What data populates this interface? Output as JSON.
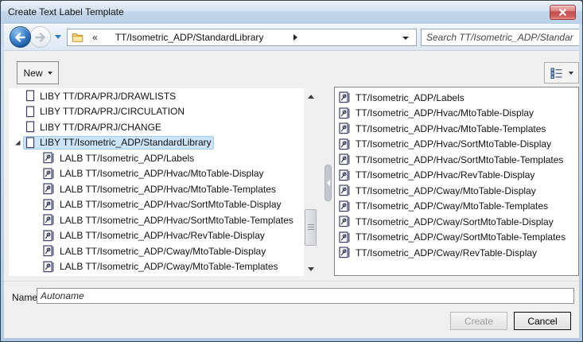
{
  "window": {
    "title": "Create Text Label Template"
  },
  "navbar": {
    "address_overflow_glyph": "«",
    "address_path": "TT/Isometric_ADP/StandardLibrary",
    "search_placeholder": "Search TT/Isometric_ADP/Standar"
  },
  "toolbar": {
    "new_button": "New"
  },
  "icons": {
    "close": "close-icon",
    "back": "back-arrow-icon",
    "forward": "forward-arrow-icon",
    "folder": "folder-icon",
    "view_mode": "details-view-icon",
    "library": "library-icon",
    "label_template": "label-template-icon"
  },
  "left_tree": {
    "items": [
      {
        "label": "LIBY TT/DRA/PRJ/DRAWLISTS",
        "level": 0,
        "icon": "library-icon",
        "selected": false,
        "expanded": false
      },
      {
        "label": "LIBY TT/DRA/PRJ/CIRCULATION",
        "level": 0,
        "icon": "library-icon",
        "selected": false,
        "expanded": false
      },
      {
        "label": "LIBY TT/DRA/PRJ/CHANGE",
        "level": 0,
        "icon": "library-icon",
        "selected": false,
        "expanded": false
      },
      {
        "label": "LIBY TT/Isometric_ADP/StandardLibrary",
        "level": 0,
        "icon": "library-icon",
        "selected": true,
        "expanded": true
      },
      {
        "label": "LALB TT/Isometric_ADP/Labels",
        "level": 1,
        "icon": "label-template-icon",
        "selected": false,
        "expanded": false
      },
      {
        "label": "LALB TT/Isometric_ADP/Hvac/MtoTable-Display",
        "level": 1,
        "icon": "label-template-icon",
        "selected": false,
        "expanded": false
      },
      {
        "label": "LALB TT/Isometric_ADP/Hvac/MtoTable-Templates",
        "level": 1,
        "icon": "label-template-icon",
        "selected": false,
        "expanded": false
      },
      {
        "label": "LALB TT/Isometric_ADP/Hvac/SortMtoTable-Display",
        "level": 1,
        "icon": "label-template-icon",
        "selected": false,
        "expanded": false
      },
      {
        "label": "LALB TT/Isometric_ADP/Hvac/SortMtoTable-Templates",
        "level": 1,
        "icon": "label-template-icon",
        "selected": false,
        "expanded": false
      },
      {
        "label": "LALB TT/Isometric_ADP/Hvac/RevTable-Display",
        "level": 1,
        "icon": "label-template-icon",
        "selected": false,
        "expanded": false
      },
      {
        "label": "LALB TT/Isometric_ADP/Cway/MtoTable-Display",
        "level": 1,
        "icon": "label-template-icon",
        "selected": false,
        "expanded": false
      },
      {
        "label": "LALB TT/Isometric_ADP/Cway/MtoTable-Templates",
        "level": 1,
        "icon": "label-template-icon",
        "selected": false,
        "expanded": false
      }
    ]
  },
  "right_list": {
    "items": [
      "TT/Isometric_ADP/Labels",
      "TT/Isometric_ADP/Hvac/MtoTable-Display",
      "TT/Isometric_ADP/Hvac/MtoTable-Templates",
      "TT/Isometric_ADP/Hvac/SortMtoTable-Display",
      "TT/Isometric_ADP/Hvac/SortMtoTable-Templates",
      "TT/Isometric_ADP/Hvac/RevTable-Display",
      "TT/Isometric_ADP/Cway/MtoTable-Display",
      "TT/Isometric_ADP/Cway/MtoTable-Templates",
      "TT/Isometric_ADP/Cway/SortMtoTable-Display",
      "TT/Isometric_ADP/Cway/SortMtoTable-Templates",
      "TT/Isometric_ADP/Cway/RevTable-Display"
    ]
  },
  "footer": {
    "name_label": "Name:",
    "name_value": "Autoname",
    "create_button": "Create",
    "cancel_button": "Cancel"
  },
  "colors": {
    "selection_bg": "#cbe4fa",
    "selection_border": "#a2cdf0",
    "titlebar_top": "#e8f1fa",
    "titlebar_bottom": "#b9cfe6",
    "close_red": "#c4504f",
    "frame_blue": "#b3cbe2",
    "dialog_bg": "#f0f0f0"
  }
}
